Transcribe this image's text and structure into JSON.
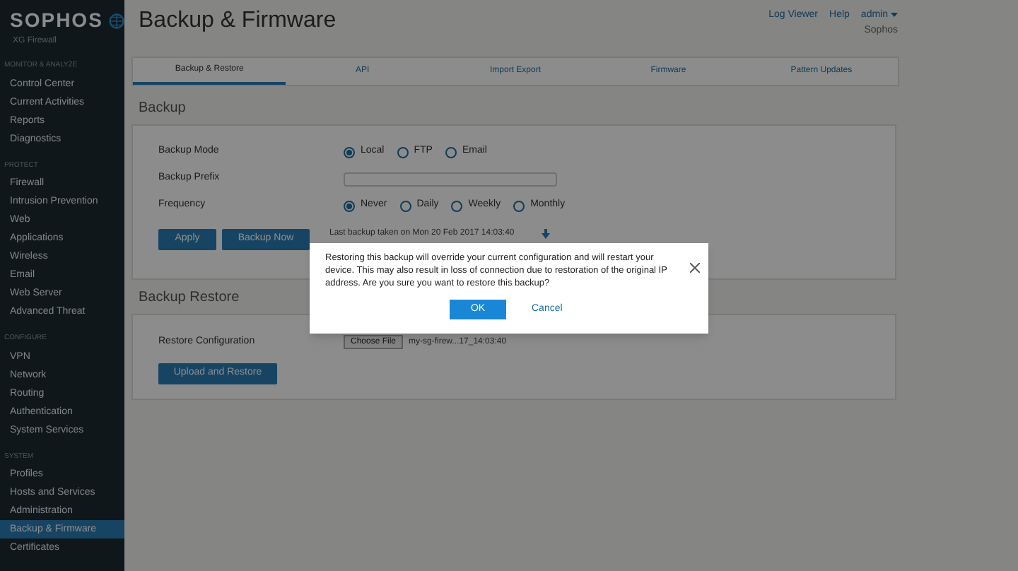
{
  "sidebar": {
    "logo": "SOPHOS",
    "product": "XG Firewall",
    "sections": [
      {
        "heading": "MONITOR & ANALYZE",
        "items": [
          {
            "label": "Control Center",
            "selected": false
          },
          {
            "label": "Current Activities",
            "selected": false
          },
          {
            "label": "Reports",
            "selected": false
          },
          {
            "label": "Diagnostics",
            "selected": false
          }
        ]
      },
      {
        "heading": "PROTECT",
        "items": [
          {
            "label": "Firewall",
            "selected": false
          },
          {
            "label": "Intrusion Prevention",
            "selected": false
          },
          {
            "label": "Web",
            "selected": false
          },
          {
            "label": "Applications",
            "selected": false
          },
          {
            "label": "Wireless",
            "selected": false
          },
          {
            "label": "Email",
            "selected": false
          },
          {
            "label": "Web Server",
            "selected": false
          },
          {
            "label": "Advanced Threat",
            "selected": false
          }
        ]
      },
      {
        "heading": "CONFIGURE",
        "items": [
          {
            "label": "VPN",
            "selected": false
          },
          {
            "label": "Network",
            "selected": false
          },
          {
            "label": "Routing",
            "selected": false
          },
          {
            "label": "Authentication",
            "selected": false
          },
          {
            "label": "System Services",
            "selected": false
          }
        ]
      },
      {
        "heading": "SYSTEM",
        "items": [
          {
            "label": "Profiles",
            "selected": false
          },
          {
            "label": "Hosts and Services",
            "selected": false
          },
          {
            "label": "Administration",
            "selected": false
          },
          {
            "label": "Backup & Firmware",
            "selected": true
          },
          {
            "label": "Certificates",
            "selected": false
          }
        ]
      }
    ]
  },
  "header": {
    "title": "Backup & Firmware",
    "links": [
      "Log Viewer",
      "Help"
    ],
    "user": "admin",
    "org": "Sophos"
  },
  "tabs": [
    {
      "label": "Backup & Restore",
      "selected": true
    },
    {
      "label": "API",
      "selected": false
    },
    {
      "label": "Import Export",
      "selected": false
    },
    {
      "label": "Firmware",
      "selected": false
    },
    {
      "label": "Pattern Updates",
      "selected": false
    }
  ],
  "backup": {
    "heading": "Backup",
    "rows": [
      {
        "kind": "radio",
        "label": "Backup Mode",
        "options": [
          {
            "label": "Local",
            "selected": true
          },
          {
            "label": "FTP",
            "selected": false
          },
          {
            "label": "Email",
            "selected": false
          }
        ]
      },
      {
        "kind": "text",
        "label": "Backup Prefix"
      },
      {
        "kind": "radio",
        "label": "Frequency",
        "options": [
          {
            "label": "Never",
            "selected": true
          },
          {
            "label": "Daily",
            "selected": false
          },
          {
            "label": "Weekly",
            "selected": false
          },
          {
            "label": "Monthly",
            "selected": false
          }
        ]
      }
    ],
    "buttons": [
      "Apply",
      "Backup Now"
    ],
    "last_backup": "Last backup taken on Mon 20 Feb 2017 14:03:40"
  },
  "restore": {
    "heading": "Backup Restore",
    "label": "Restore Configuration",
    "file_button": "Choose File",
    "file_name": "my-sg-firew...17_14:03:40",
    "button": "Upload and Restore"
  },
  "dialog": {
    "message": "Restoring this backup will override your current configuration and will restart your device. This may also result in loss of connection due to restoration of the original IP address. Are you sure you want to restore this backup?",
    "ok": "OK",
    "cancel": "Cancel"
  }
}
